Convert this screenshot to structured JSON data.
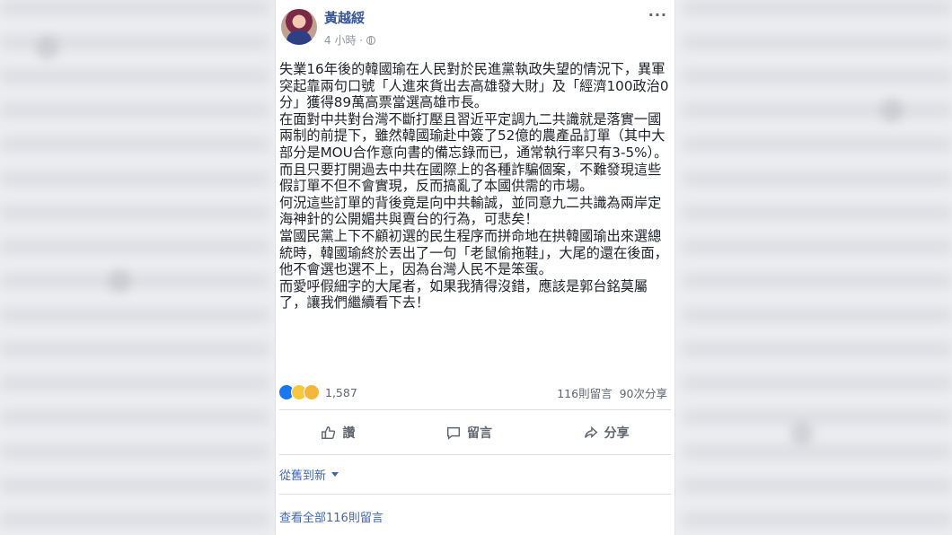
{
  "post": {
    "author": "黃越綏",
    "time": "4 小時 ·",
    "paragraphs": [
      "失業16年後的韓國瑜在人民對於民進黨執政失望的情況下，異軍突起靠兩句口號「人進來貨出去高雄發大財」及「經濟100政治0分」獲得89萬高票當選高雄市長。",
      "在面對中共對台灣不斷打壓且習近平定調九二共識就是落實一國兩制的前提下，雖然韓國瑜赴中簽了52億的農產品訂單（其中大部分是MOU合作意向書的備忘錄而已，通常執行率只有3-5%）。",
      "而且只要打開過去中共在國際上的各種詐騙個案，不難發現這些假訂單不但不會實現，反而搞亂了本國供需的市場。",
      "何況這些訂單的背後竟是向中共輸誠，並同意九二共識為兩岸定海神針的公開媚共與賣台的行為，可悲矣！",
      "當國民黨上下不顧初選的民生程序而拼命地在拱韓國瑜出來選總統時，韓國瑜終於丟出了一句「老鼠偷拖鞋」，大尾的還在後面，他不會選也選不上，因為台灣人民不是笨蛋。",
      "而愛呼假細字的大尾者，如果我猜得沒錯，應該是郭台銘莫屬了，讓我們繼續看下去！"
    ]
  },
  "stats": {
    "reaction_count": "1,587",
    "comments": "116則留言",
    "shares": "90次分享"
  },
  "actions": {
    "like": "讚",
    "comment": "留言",
    "share": "分享"
  },
  "comments_section": {
    "sort_label": "從舊到新",
    "view_all": "查看全部116則留言"
  }
}
